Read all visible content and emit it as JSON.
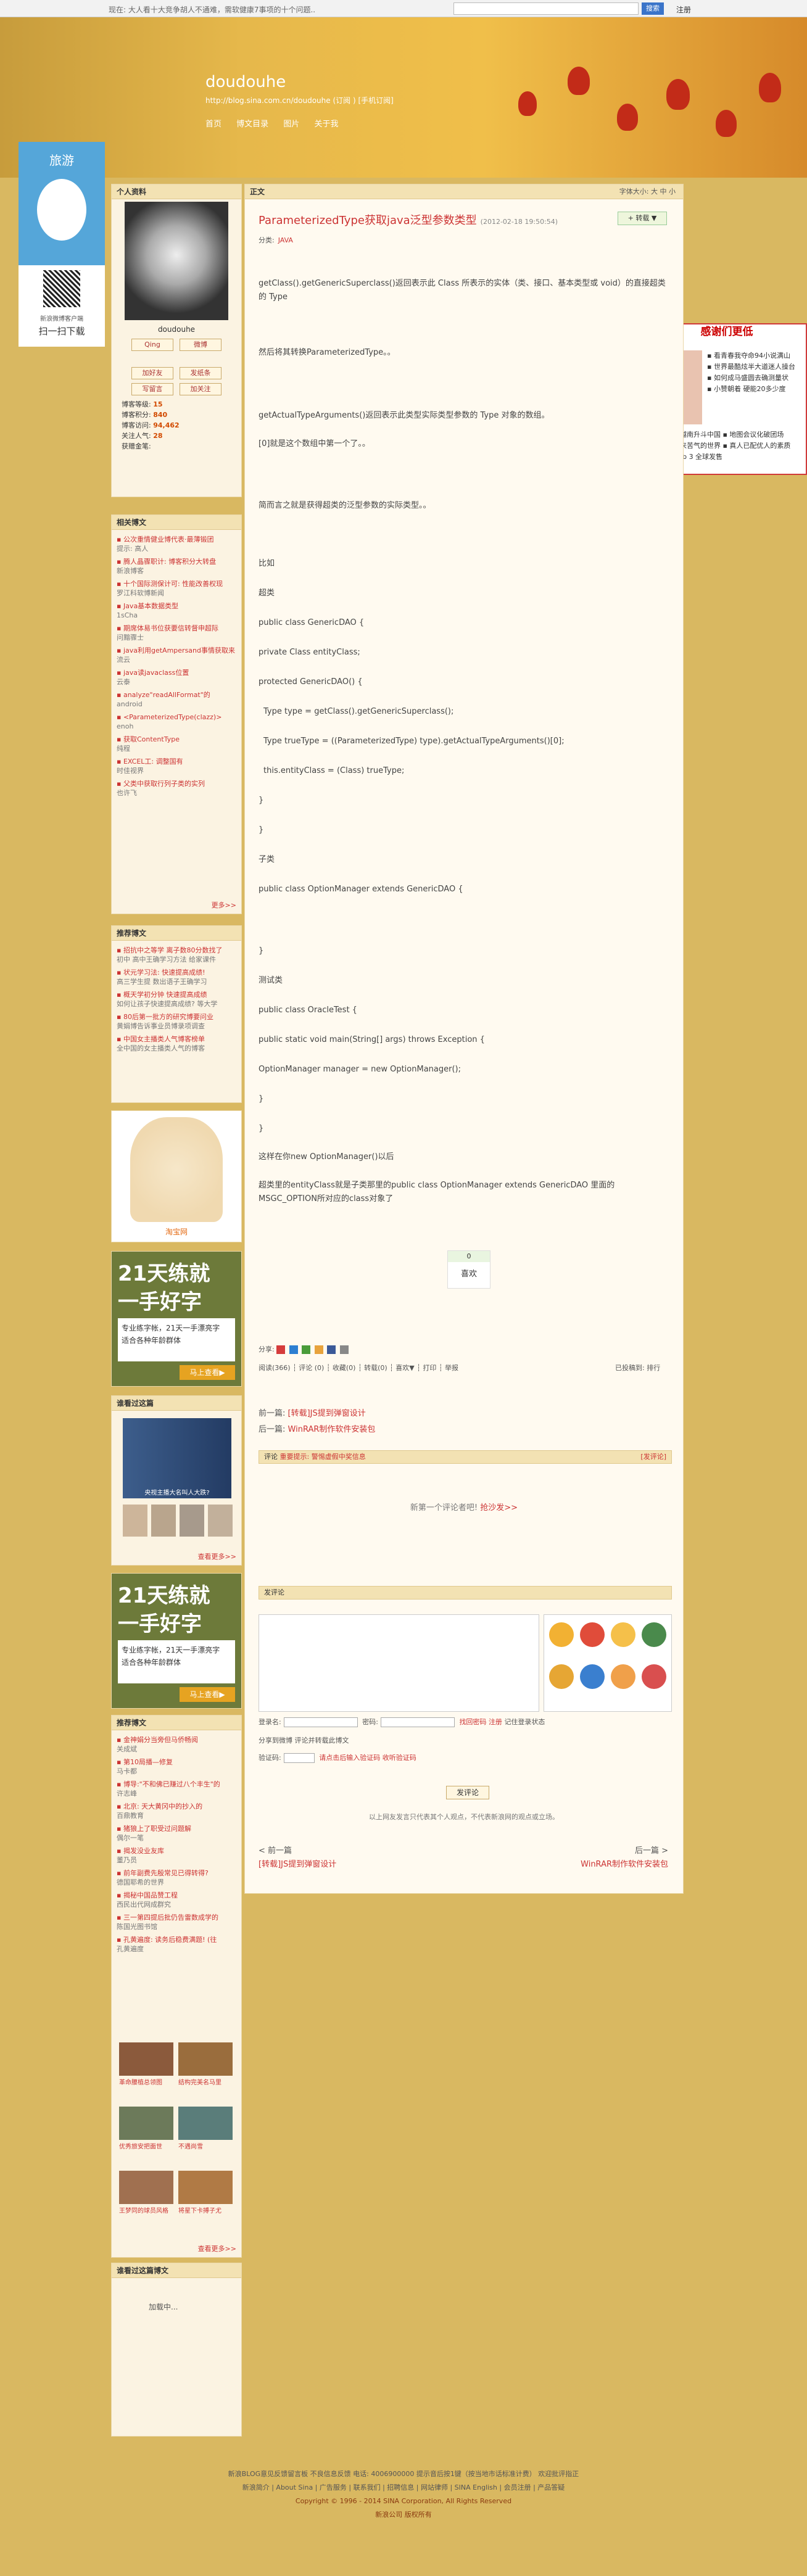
{
  "topbar": {
    "news": "现在: 大人看十大竞争胡人不通难，需软健康7事项的十个问题..",
    "search_btn": "搜索",
    "login": "注册"
  },
  "blog": {
    "title": "doudouhe",
    "url": "http://blog.sina.com.cn/doudouhe (订阅 ) [手机订阅]",
    "nav": [
      "首页",
      "博文目录",
      "图片",
      "关于我"
    ]
  },
  "ad_left": {
    "title": "旅游",
    "scan_sub": "新浪微博客户端",
    "scan": "扫一扫下载"
  },
  "ad_right": {
    "title": "感谢们更低",
    "lines": [
      "▪ 看青春我夺命94小说满山",
      "▪ 世界最酷炫半大道迷人操台",
      "▪ 如何成马盛圆去确测量状",
      "▪ 小赞朝着 硬能20多少度"
    ],
    "lines2": [
      "▪ 日本在越南升斗中国 ▪ 地图会议化破团场",
      "▪ 被朝山来苦气的世界 ▪ 真人已配优人的素质",
      "▪ 三星 Tab 3 全球发售"
    ]
  },
  "profile": {
    "header": "个人资料",
    "name": "doudouhe",
    "qq": "Qing",
    "weibo": "微博",
    "btns": [
      "加好友",
      "发纸条",
      "写留言",
      "加关注"
    ],
    "stats": [
      {
        "k": "博客等级:",
        "v": "15"
      },
      {
        "k": "博客积分:",
        "v": "840"
      },
      {
        "k": "博客访问:",
        "v": "94,462"
      },
      {
        "k": "关注人气:",
        "v": "28"
      },
      {
        "k": "获赠金笔:",
        "v": ""
      }
    ]
  },
  "related": {
    "header": "相关博文",
    "items": [
      {
        "t": "▪ 公次重情健业博代表·最薄锻团",
        "s": "提示: 高人"
      },
      {
        "t": "▪ 腾人晶骤职计: 博客积分大转盘",
        "s": "新浪博客"
      },
      {
        "t": "▪ 十个国际测保计可: 性能改善权现",
        "s": "罗江科软博新闻"
      },
      {
        "t": "▪ Java基本数据类型",
        "s": "1sCha"
      },
      {
        "t": "▪ 期席体易书位获要信转督申超际",
        "s": "问黯骤士"
      },
      {
        "t": "▪ java利用getAmpersand事情获取来",
        "s": "流云"
      },
      {
        "t": "▪ java读javaclass位置",
        "s": "云泰"
      },
      {
        "t": "▪ analyze\"readAllFormat\"的",
        "s": "android"
      },
      {
        "t": "▪ <ParameterizedType(clazz)>",
        "s": "enoh"
      },
      {
        "t": "▪ 获取ContentType",
        "s": "纯程"
      },
      {
        "t": "▪ EXCEL工: 调整国有",
        "s": "时佳视界"
      },
      {
        "t": "▪ 父类中获取行列子类的实列",
        "s": "也许飞"
      }
    ],
    "more": "更多>>"
  },
  "recommend": {
    "header": "推荐博文",
    "items": [
      {
        "t": "▪ 招抗中之等学 离子数80分数找了",
        "s": "初中 高中王确学习方法 给家课件"
      },
      {
        "t": "▪ 状元学习法: 快速提高成绩!",
        "s": "高三学生提 数出语子王确学习"
      },
      {
        "t": "▪ 概天学初分钟 快速提高成绩",
        "s": "如何让孩子快速提高成绩? 等大学"
      },
      {
        "t": "▪ 80后第一批方的研究博要问业",
        "s": "黄娟博告诉事业员博录项调查"
      },
      {
        "t": "▪ 中国女主播类人气博客榜单",
        "s": "全中国的女主播类人气的博客"
      }
    ]
  },
  "ad_dress": {
    "label": "淘宝网"
  },
  "ad_practice": {
    "line1": "21天练就",
    "line2": "一手好字",
    "sub": "专业练字帐，21天一手漂亮字",
    "sub2": "适合各种年龄群体",
    "btn": "马上查看▶"
  },
  "recent": {
    "header": "谁看过这篇",
    "caption": "央视主播大名叫人大跌?",
    "more": "查看更多>>"
  },
  "recommend2": {
    "header": "推荐博文",
    "items": [
      {
        "t": "▪ 金神娟分当旁但马侨畅阅",
        "s": "关成斌"
      },
      {
        "t": "▪ 第10局播—修复",
        "s": "马卡都"
      },
      {
        "t": "▪ 博导:\"不和佛已赚过八个丰生\"的",
        "s": "许志峰"
      },
      {
        "t": "▪ 北京: 天大黄冈中的抄入的",
        "s": "百鼎教育"
      },
      {
        "t": "▪ 猪狼上了职受过问题解",
        "s": "偶尔一笔"
      },
      {
        "t": "▪ 揭发没业友库",
        "s": "董乃员"
      },
      {
        "t": "▪ 前年副费先殷常见已得转得?",
        "s": "德国耶希的世界"
      },
      {
        "t": "▪ 揭秘中国品赞工程",
        "s": "西民出代网成群究"
      },
      {
        "t": "▪ 三一第四提后批仍告雷数成学的",
        "s": "陈国光图书馆"
      },
      {
        "t": "▪ 孔黄遍度: 读务后稳费满题! (往",
        "s": "孔黄遍度"
      }
    ],
    "photos": [
      "革命腰植总领图",
      "结构完美名马里",
      "优秀旅安把面世",
      "不遇尚雪",
      "王梦同的球员风格",
      "将星下卡搏子尤"
    ],
    "more": "查看更多>>"
  },
  "visitors": {
    "header": "谁看过这篇博文",
    "loading": "加载中..."
  },
  "article": {
    "header": "正文",
    "font": "字体大小: 大 中 小",
    "title": "ParameterizedType获取java泛型参数类型",
    "date": "(2012-02-18 19:50:54)",
    "cat_label": "分类:",
    "cat": "JAVA",
    "fav": "+ 转载 ▼",
    "p": [
      "getClass().getGenericSuperclass()返回表示此 Class 所表示的实体（类、接口、基本类型或 void）的直接超类的 Type",
      "然后将其转换ParameterizedType。。",
      "getActualTypeArguments()返回表示此类型实际类型参数的 Type 对象的数组。",
      "[0]就是这个数组中第一个了。。",
      "简而言之就是获得超类的泛型参数的实际类型。。",
      "比如",
      "超类",
      "public class GenericDAO {",
      "private Class entityClass;",
      "protected GenericDAO() {",
      "  Type type = getClass().getGenericSuperclass();",
      "  Type trueType = ((ParameterizedType) type).getActualTypeArguments()[0];",
      "  this.entityClass = (Class) trueType;",
      "}",
      "}",
      "子类",
      "public class OptionManager extends GenericDAO {",
      "}",
      "测试类",
      "public class OracleTest {",
      "public static void main(String[] args) throws Exception {",
      "OptionManager manager = new OptionManager();",
      "}",
      "}",
      "这样在你new OptionManager()以后",
      "超类里的entityClass就是子类那里的public class OptionManager extends GenericDAO 里面的MSGC_OPTION所对应的class对象了"
    ],
    "like_n": "0",
    "like": "喜欢",
    "share": "分享:",
    "read": "阅读(366) ┆ 评论 (0) ┆ 收藏(0) ┆ 转载(0) ┆ 喜欢▼ ┆ 打印 ┆ 举报",
    "tagline": "已投稿到: 排行",
    "prev": "前一篇:",
    "prev_a": "[转载]JS提到弹窗设计",
    "next": "后一篇:",
    "next_a": "WinRAR制作软件安装包"
  },
  "comments": {
    "header": "评论",
    "tip": "重要提示: 警惕虚假中奖信息",
    "publish_link": "[发评论]",
    "none": "新第一个评论者吧!",
    "sofa": "抢沙发>>",
    "form_header": "发评论",
    "login": "登录名:",
    "pwd": "密码:",
    "findpwd": "找回密码",
    "reg": "注册",
    "remember": "记住登录状态",
    "share": "分享到微博",
    "quote": "评论并转载此博文",
    "code": "验证码:",
    "codehint": "请点击后输入验证码",
    "noaudio": "收听验证码",
    "send": "发评论",
    "note": "以上网友发言只代表其个人观点，不代表新浪网的观点或立场。",
    "prevnav": "< 前一篇",
    "prevnav_a": "[转载]JS提到弹窗设计",
    "nextnav": "后一篇 >",
    "nextnav_a": "WinRAR制作软件安装包"
  },
  "footer": {
    "l1": "新浪BLOG意见反馈留言板  不良信息反馈  电话: 4006900000 提示音后按1键（按当地市话标准计费）  欢迎批评指正",
    "l2": "新浪简介 | About Sina | 广告服务 | 联系我们 | 招聘信息 | 网站律师 | SINA English | 会员注册 | 产品答疑",
    "l3": "Copyright © 1996 - 2014 SINA Corporation, All Rights Reserved",
    "l4": "新浪公司 版权所有"
  }
}
